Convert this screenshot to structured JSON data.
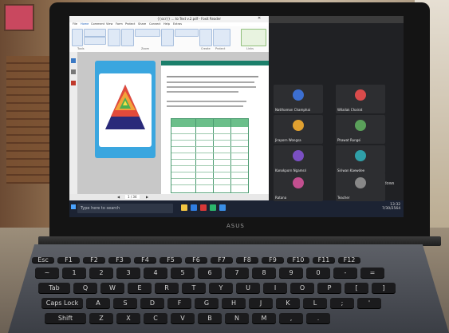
{
  "app_window": {
    "title": "{{ocr}} ... to Text v.2.pdf - Foxit Reader",
    "ribbon_tabs": [
      "File",
      "Home",
      "Comment",
      "View",
      "Form",
      "Protect",
      "Share",
      "Connect",
      "Help",
      "Extras"
    ],
    "ribbon_groups": [
      "Tools",
      "Zoom",
      "Create",
      "Protect",
      "Links"
    ],
    "status_page": "1 / 34"
  },
  "meeting": {
    "participants": [
      {
        "name": "Natthamon Champhai",
        "color": "#3c6fd1"
      },
      {
        "name": "Wilailak Chairat",
        "color": "#d94b4b"
      },
      {
        "name": "Jiraporn Wongsa",
        "color": "#e0a030"
      },
      {
        "name": "Phawat Rungsi",
        "color": "#5aa05a"
      },
      {
        "name": "Kanokporn Ngamsri",
        "color": "#7a4fc2"
      },
      {
        "name": "Siriwan Kaewdee",
        "color": "#2f9fa8"
      },
      {
        "name": "Ratana",
        "color": "#c24f8f"
      },
      {
        "name": "Teacher",
        "color": "#888888"
      }
    ],
    "activate_text": "Activate Windows"
  },
  "taskbar": {
    "search_placeholder": "Type here to search",
    "time": "13:32",
    "date": "7/30/2564"
  },
  "laptop": {
    "brand": "ASUS"
  },
  "keyboard": {
    "row1": [
      "Esc",
      "F1",
      "F2",
      "F3",
      "F4",
      "F5",
      "F6",
      "F7",
      "F8",
      "F9",
      "F10",
      "F11",
      "F12"
    ],
    "row2": [
      "~",
      "1",
      "2",
      "3",
      "4",
      "5",
      "6",
      "7",
      "8",
      "9",
      "0",
      "-",
      "="
    ],
    "row3": [
      "Tab",
      "Q",
      "W",
      "E",
      "R",
      "T",
      "Y",
      "U",
      "I",
      "O",
      "P",
      "[",
      "]"
    ],
    "row4": [
      "Caps Lock",
      "A",
      "S",
      "D",
      "F",
      "G",
      "H",
      "J",
      "K",
      "L",
      ";",
      "'"
    ],
    "row5": [
      "Shift",
      "Z",
      "X",
      "C",
      "V",
      "B",
      "N",
      "M",
      ",",
      "."
    ]
  }
}
